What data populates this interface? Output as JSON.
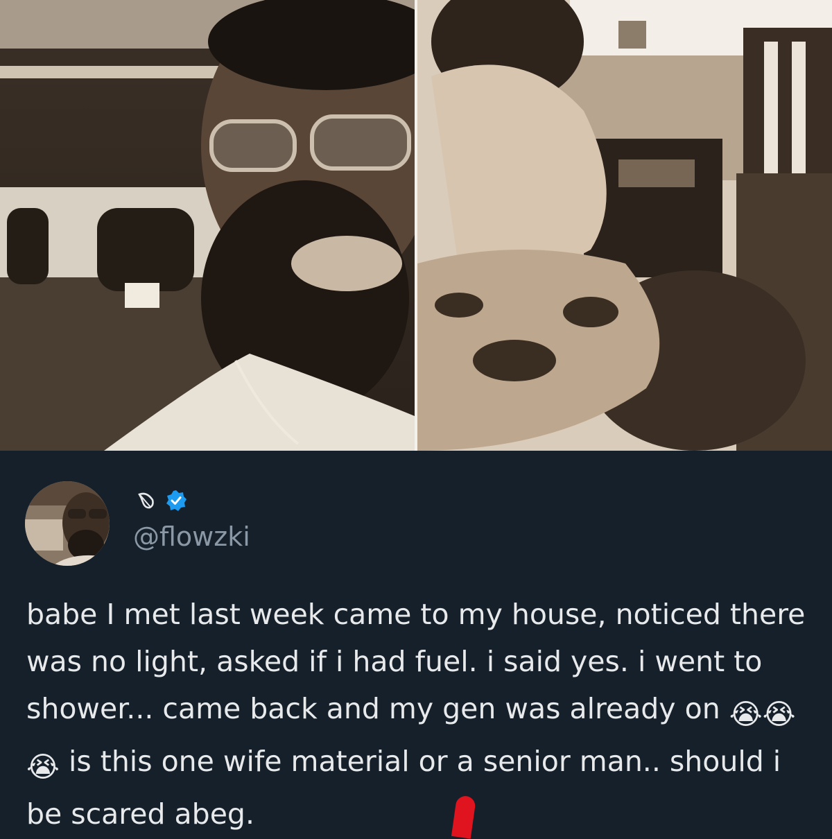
{
  "tweet": {
    "display_name_icon": "leaf-icon",
    "verified_icon": "verified-badge-icon",
    "handle": "@flowzki",
    "text_before_emoji": "babe I met last week came to my house, noticed there was no light, asked if i had fuel. i said yes. i went to shower... came back and my gen was already on ",
    "emoji": [
      "😭",
      "😭",
      "😭"
    ],
    "text_after_emoji": " is this one wife material or a senior man.. should i be scared abeg."
  },
  "colors": {
    "background": "#15202b",
    "text": "#e7e9ea",
    "handle": "#8b98a5",
    "verified": "#1d9bf0",
    "mark": "#e0141e"
  }
}
